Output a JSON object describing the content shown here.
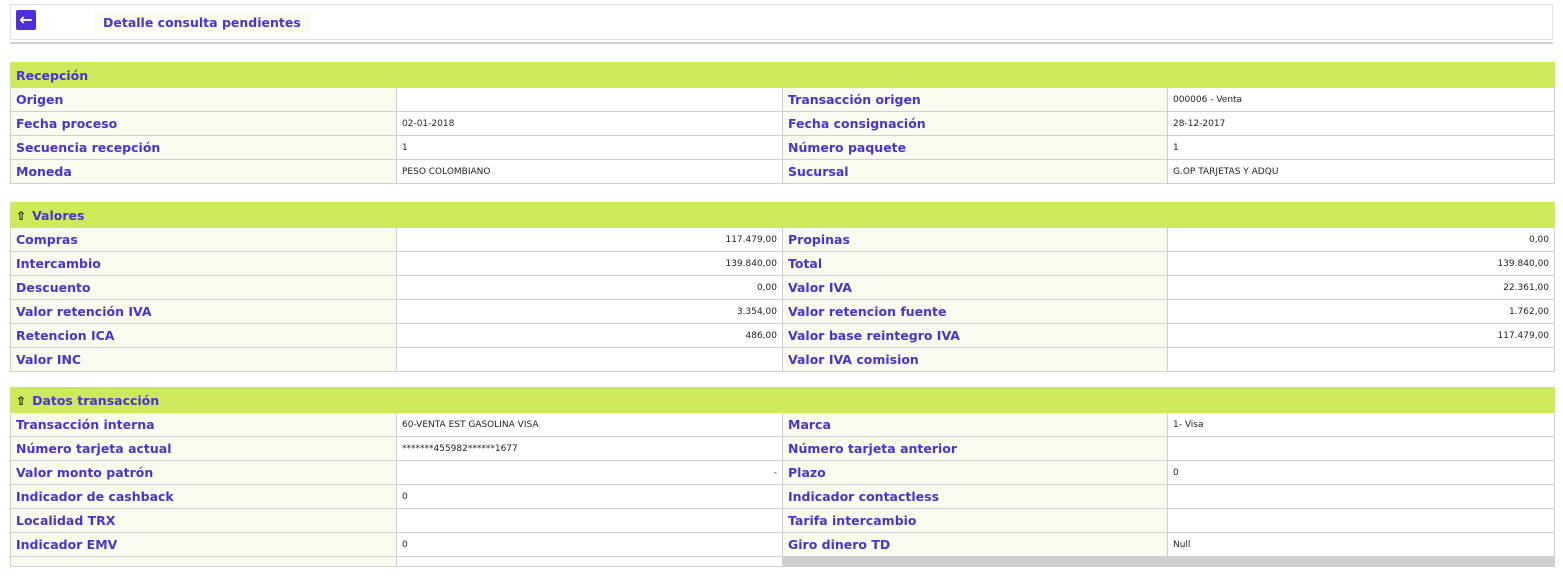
{
  "header": {
    "title": "Detalle consulta pendientes"
  },
  "sections": [
    {
      "title": "Recepción",
      "collapsible": false,
      "rows": [
        [
          "Origen",
          "",
          "Transacción origen",
          "000006 -  Venta"
        ],
        [
          "Fecha proceso",
          "02-01-2018",
          "Fecha consignación",
          "28-12-2017"
        ],
        [
          "Secuencia recepción",
          "1",
          "Número paquete",
          "1"
        ],
        [
          "Moneda",
          "PESO COLOMBIANO",
          "Sucursal",
          "G.OP TARJETAS Y ADQU"
        ]
      ]
    },
    {
      "title": "Valores",
      "collapsible": true,
      "numeric": true,
      "rows": [
        [
          "Compras",
          "117.479,00",
          "Propinas",
          "0,00"
        ],
        [
          "Intercambio",
          "139.840,00",
          "Total",
          "139.840,00"
        ],
        [
          "Descuento",
          "0,00",
          "Valor IVA",
          "22.361,00"
        ],
        [
          "Valor retención IVA",
          "3.354,00",
          "Valor retencion fuente",
          "1.762,00"
        ],
        [
          "Retencion ICA",
          "486,00",
          "Valor base reintegro IVA",
          "117.479,00"
        ],
        [
          "Valor INC",
          "",
          "Valor IVA comision",
          ""
        ]
      ]
    },
    {
      "title": "Datos transacción",
      "collapsible": true,
      "rows": [
        [
          "Transacción interna",
          "60-VENTA EST GASOLINA VISA",
          "Marca",
          "1-  Visa"
        ],
        [
          "Número tarjeta actual",
          "*******455982******1677",
          "Número tarjeta anterior",
          ""
        ],
        [
          "Valor monto patrón",
          "-",
          "Plazo",
          "0"
        ],
        [
          "Indicador de cashback",
          "0",
          "Indicador contactless",
          ""
        ],
        [
          "Localidad TRX",
          "",
          "Tarifa intercambio",
          ""
        ],
        [
          "Indicador EMV",
          "0",
          "Giro dinero TD",
          "Null"
        ]
      ]
    }
  ]
}
